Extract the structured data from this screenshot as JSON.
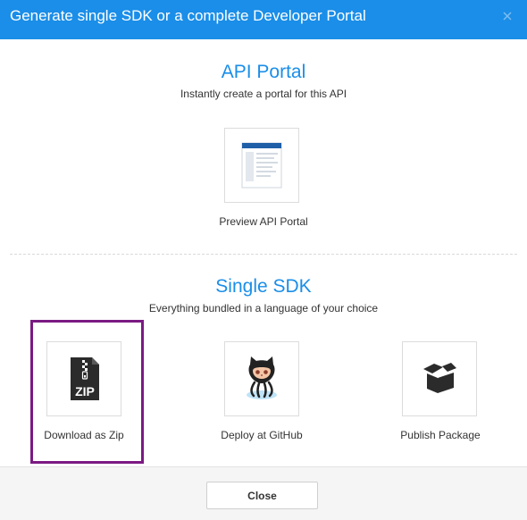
{
  "dialog": {
    "title": "Generate single SDK or a complete Developer Portal",
    "close_icon": "close-icon"
  },
  "api_portal": {
    "title": "API Portal",
    "subtitle": "Instantly create a portal for this API",
    "options": [
      {
        "label": "Preview API Portal",
        "icon": "portal-preview-icon"
      }
    ]
  },
  "single_sdk": {
    "title": "Single SDK",
    "subtitle": "Everything bundled in a language of your choice",
    "options": [
      {
        "label": "Download as Zip",
        "icon": "zip-file-icon",
        "selected": true
      },
      {
        "label": "Deploy at GitHub",
        "icon": "github-octocat-icon"
      },
      {
        "label": "Publish Package",
        "icon": "package-box-icon"
      }
    ]
  },
  "footer": {
    "close_label": "Close"
  },
  "colors": {
    "header": "#1a8ee8",
    "accent": "#1a8ee8",
    "selection_border": "#7b1a83",
    "footer_bg": "#f5f5f5"
  }
}
